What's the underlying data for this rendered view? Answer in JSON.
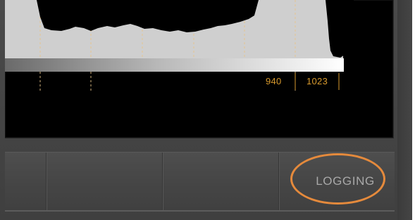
{
  "scope": {
    "scale_labels": [
      "940",
      "1023"
    ]
  },
  "toolbar": {
    "logging_label": "LOGGING"
  },
  "colors": {
    "label_accent": "#d89a2e",
    "highlight_ring": "#e58a3c"
  }
}
